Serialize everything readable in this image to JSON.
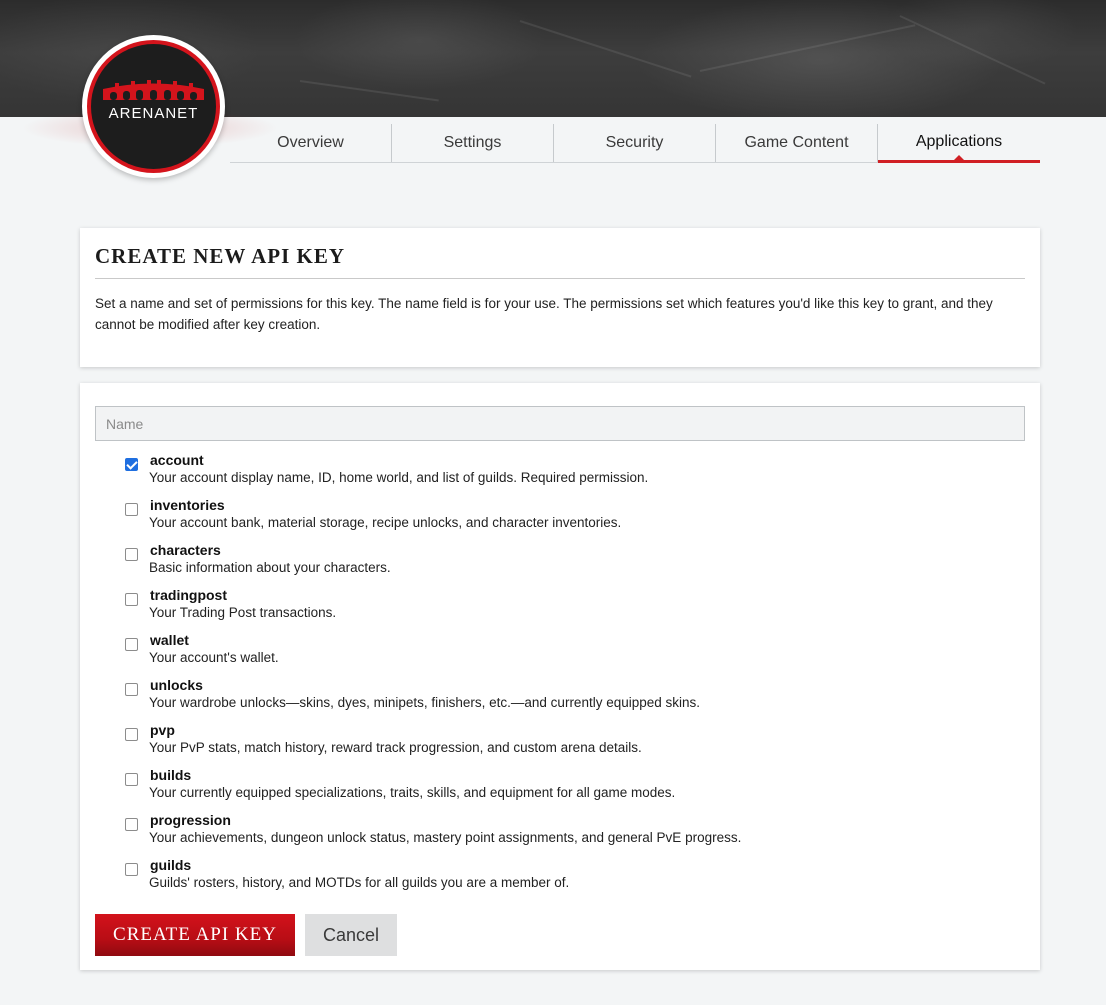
{
  "brand": {
    "logo_text": "ARENANET"
  },
  "tabs": [
    {
      "label": "Overview",
      "active": false
    },
    {
      "label": "Settings",
      "active": false
    },
    {
      "label": "Security",
      "active": false
    },
    {
      "label": "Game Content",
      "active": false
    },
    {
      "label": "Applications",
      "active": true
    }
  ],
  "intro": {
    "title": "CREATE NEW API KEY",
    "text": "Set a name and set of permissions for this key. The name field is for your use. The permissions set which features you'd like this key to grant, and they cannot be modified after key creation."
  },
  "form": {
    "name_placeholder": "Name",
    "name_value": "",
    "permissions": [
      {
        "name": "account",
        "description": "Your account display name, ID, home world, and list of guilds. Required permission.",
        "checked": true
      },
      {
        "name": "inventories",
        "description": "Your account bank, material storage, recipe unlocks, and character inventories.",
        "checked": false
      },
      {
        "name": "characters",
        "description": "Basic information about your characters.",
        "checked": false
      },
      {
        "name": "tradingpost",
        "description": "Your Trading Post transactions.",
        "checked": false
      },
      {
        "name": "wallet",
        "description": "Your account's wallet.",
        "checked": false
      },
      {
        "name": "unlocks",
        "description": "Your wardrobe unlocks—skins, dyes, minipets, finishers, etc.—and currently equipped skins.",
        "checked": false
      },
      {
        "name": "pvp",
        "description": "Your PvP stats, match history, reward track progression, and custom arena details.",
        "checked": false
      },
      {
        "name": "builds",
        "description": "Your currently equipped specializations, traits, skills, and equipment for all game modes.",
        "checked": false
      },
      {
        "name": "progression",
        "description": "Your achievements, dungeon unlock status, mastery point assignments, and general PvE progress.",
        "checked": false
      },
      {
        "name": "guilds",
        "description": "Guilds' rosters, history, and MOTDs for all guilds you are a member of.",
        "checked": false
      }
    ],
    "create_label": "CREATE API KEY",
    "cancel_label": "Cancel"
  },
  "colors": {
    "accent_red": "#d01f24",
    "checkbox_blue": "#1f6fe0",
    "page_bg": "#f3f5f6"
  }
}
